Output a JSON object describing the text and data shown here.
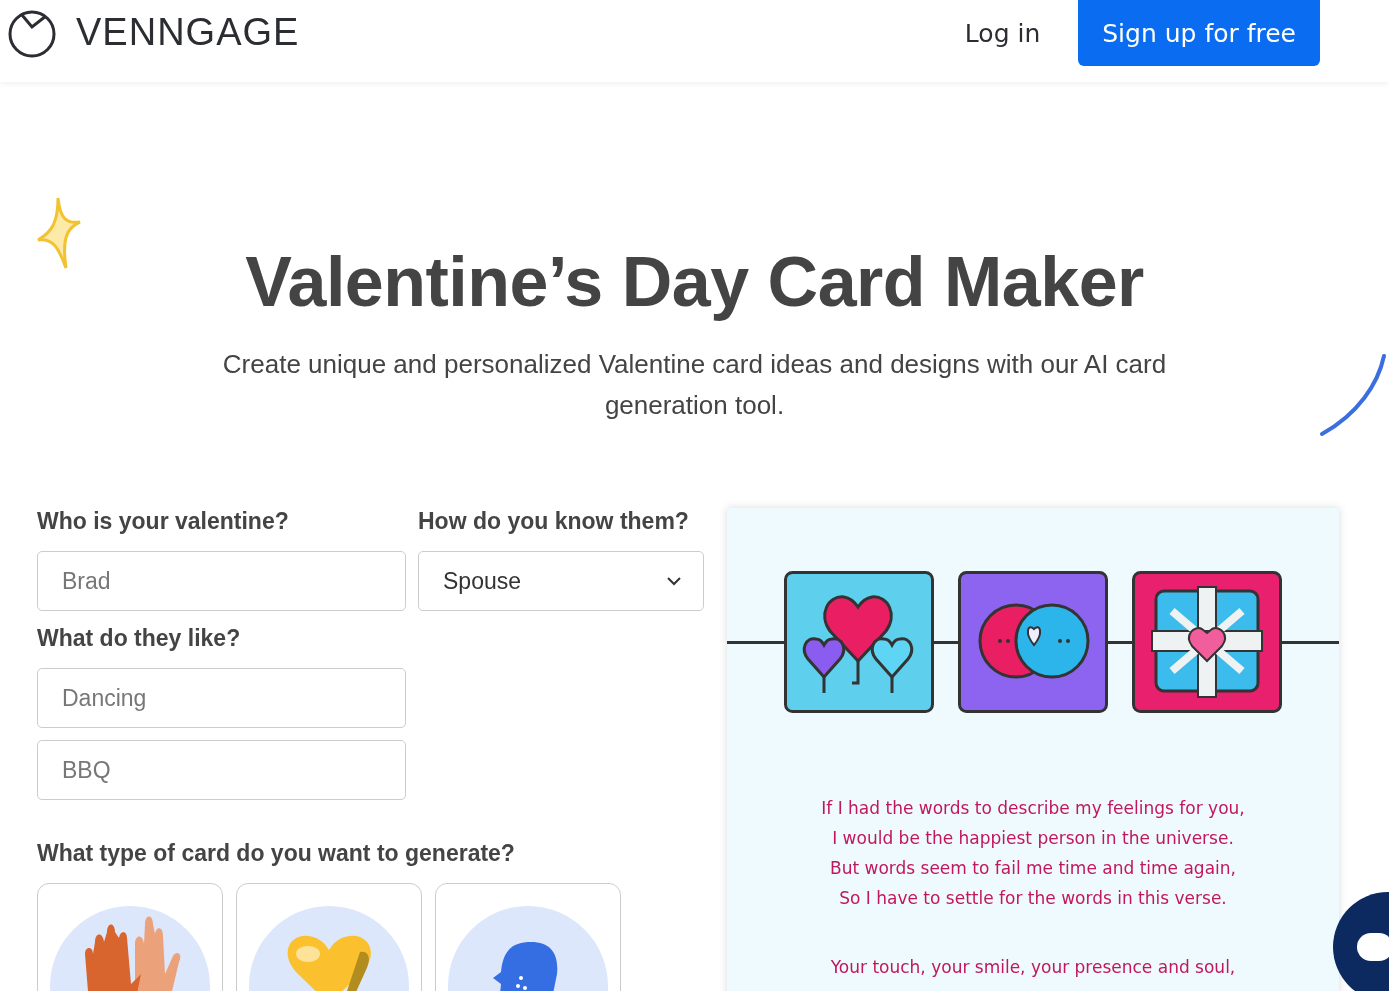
{
  "header": {
    "logo": "VENNGAGE",
    "login": "Log in",
    "signup": "Sign up for free"
  },
  "hero": {
    "title": "Valentine’s Day Card Maker",
    "subtitle": "Create unique and personalized Valentine card ideas and designs with our AI card generation tool."
  },
  "form": {
    "valentine": {
      "label": "Who is your valentine?",
      "placeholder": "Brad"
    },
    "relation": {
      "label": "How do you know them?",
      "value": "Spouse"
    },
    "likes": {
      "label": "What do they like?",
      "fields": [
        {
          "placeholder": "Dancing"
        },
        {
          "placeholder": "BBQ"
        }
      ]
    },
    "card_type": {
      "label": "What type of card do you want to generate?",
      "options": [
        {
          "kind": "hands"
        },
        {
          "kind": "heart"
        },
        {
          "kind": "head"
        }
      ]
    }
  },
  "preview": {
    "stanzas": [
      [
        "If I had the words to describe my feelings for you,",
        "I would be the happiest person in the universe.",
        "But words seem to fail me time and time again,",
        "So I have to settle for the words in this verse."
      ],
      [
        "Your touch, your smile, your presence and soul,"
      ]
    ]
  }
}
